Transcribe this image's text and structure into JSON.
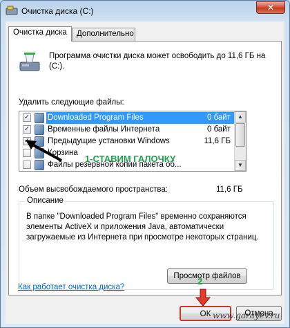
{
  "window": {
    "title": "Очистка диска  (C:)",
    "close_label": "✕"
  },
  "tabs": [
    {
      "label": "Очистка диска",
      "active": true
    },
    {
      "label": "Дополнительно",
      "active": false
    }
  ],
  "intro_text": "Программа очистки диска может освободить до 11,6 ГБ на  (C:).",
  "files_label": "Удалить следующие файлы:",
  "files": [
    {
      "name": "Downloaded Program Files",
      "size": "0 байт",
      "checked": true,
      "selected": true
    },
    {
      "name": "Временные файлы Интернета",
      "size": "0 байт",
      "checked": true,
      "selected": false
    },
    {
      "name": "Предыдущие установки Windows",
      "size": "11,6 ГБ",
      "checked": true,
      "selected": false
    },
    {
      "name": "Корзина",
      "size": "",
      "checked": false,
      "selected": false
    },
    {
      "name": "Файлы резервной копии пакета об...",
      "size": "",
      "checked": false,
      "selected": false
    }
  ],
  "annotations": {
    "step1": "1-СТАВИМ ГАЛОЧКУ",
    "step2": "2"
  },
  "space": {
    "label": "Объем высвобождаемого пространства:",
    "value": "11,6 ГБ"
  },
  "description": {
    "title": "Описание",
    "text": "В папке \"Downloaded Program Files\" временно сохраняются элементы ActiveX и приложения Java, автоматически загружаемые из Интернета при просмотре некоторых страниц."
  },
  "buttons": {
    "view_files": "Просмотр файлов",
    "ok": "ОК",
    "cancel": "Отмена"
  },
  "help_link": "Как работает очистка диска?",
  "watermark": "www.garayev.ru",
  "colors": {
    "selection": "#3399ff",
    "annotation_green": "#1aa34a",
    "annotation_red": "#c0392b",
    "link": "#0066cc"
  }
}
